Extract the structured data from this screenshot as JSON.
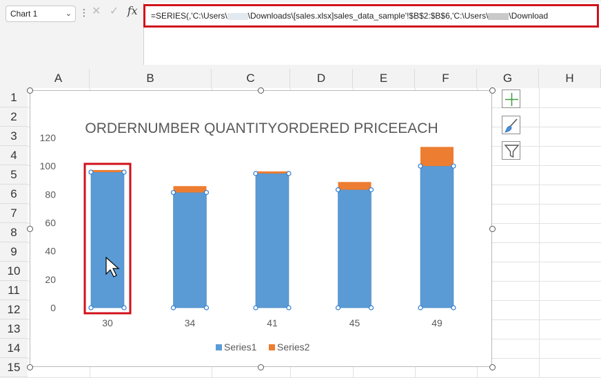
{
  "namebox": {
    "value": "Chart 1"
  },
  "formula": {
    "part1": "=SERIES(,'C:\\Users\\",
    "part2": "\\Downloads\\[sales.xlsx]sales_data_sample'!$B$2:$B$6,'C:\\Users\\",
    "part3": "\\Download"
  },
  "columns": [
    "A",
    "B",
    "C",
    "D",
    "E",
    "F",
    "G",
    "H"
  ],
  "rows": [
    "1",
    "2",
    "3",
    "4",
    "5",
    "6",
    "7",
    "8",
    "9",
    "10",
    "11",
    "12",
    "13",
    "14",
    "15"
  ],
  "icons": {
    "cancel": "close-icon",
    "enter": "check-icon",
    "chart_elements": "plus-icon",
    "chart_styles": "paintbrush-icon",
    "chart_filters": "funnel-icon"
  },
  "colors": {
    "series1": "#5b9bd5",
    "series2": "#ed7d31",
    "selection": "#d0101a"
  },
  "chart_data": {
    "type": "bar",
    "title": "ORDERNUMBER QUANTITYORDERED PRICEEACH",
    "categories": [
      "30",
      "34",
      "41",
      "45",
      "49"
    ],
    "series": [
      {
        "name": "Series1",
        "values": [
          95.7,
          81.35,
          94.74,
          83.26,
          100
        ]
      },
      {
        "name": "Series2",
        "values": [
          1.5,
          4.5,
          1.5,
          5.5,
          13.5
        ]
      }
    ],
    "stacked": true,
    "ylim": [
      0,
      120
    ],
    "yticks": [
      "0",
      "20",
      "40",
      "60",
      "80",
      "100",
      "120"
    ],
    "grid": false,
    "legend": "bottom"
  },
  "selected_point": {
    "series": "Series1",
    "category": "30"
  }
}
